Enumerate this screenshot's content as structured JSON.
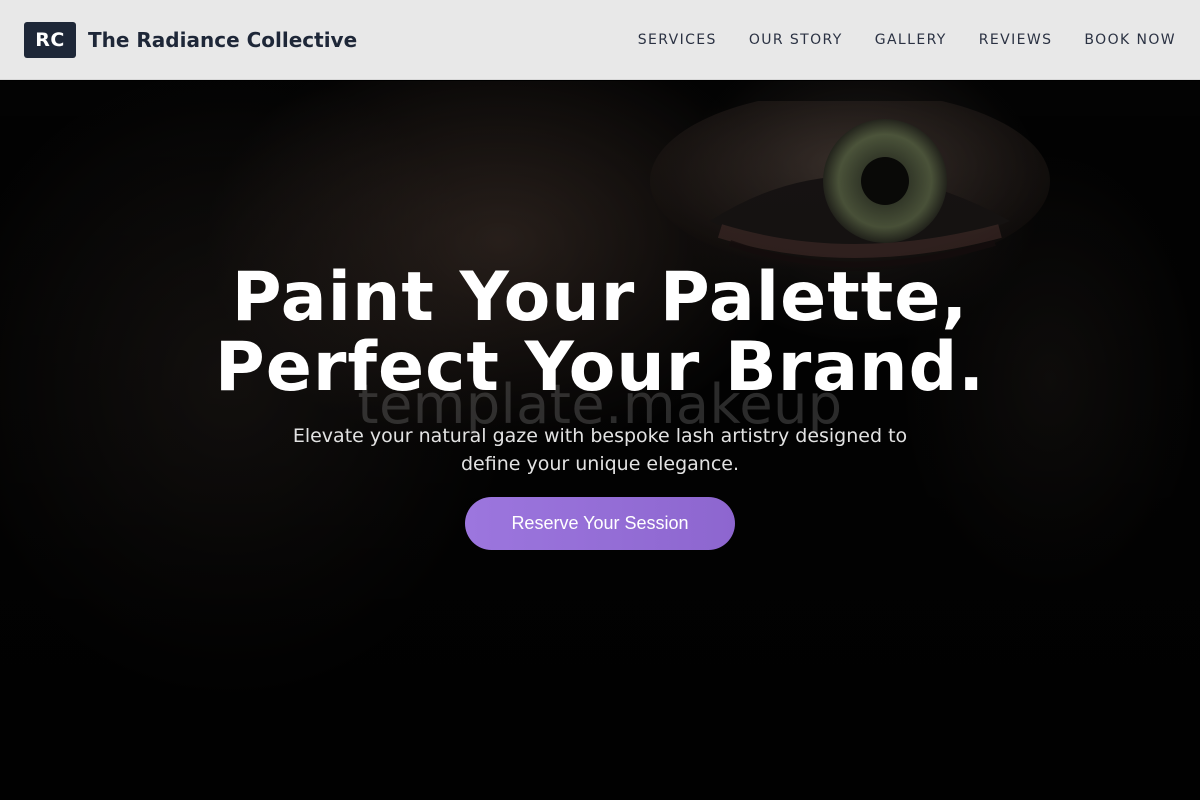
{
  "header": {
    "logo_initials": "RC",
    "brand_name": "The Radiance Collective",
    "nav": [
      {
        "label": "SERVICES"
      },
      {
        "label": "OUR STORY"
      },
      {
        "label": "GALLERY"
      },
      {
        "label": "REVIEWS"
      },
      {
        "label": "BOOK NOW"
      }
    ]
  },
  "hero": {
    "title_line1": "Paint Your Palette,",
    "title_line2": "Perfect Your Brand.",
    "subtitle_line1": "Elevate your natural gaze with bespoke lash artistry designed to",
    "subtitle_line2": "define your unique elegance.",
    "cta_label": "Reserve Your Session",
    "watermark": "template.makeup",
    "background_image": "close-up-eye-photo"
  },
  "colors": {
    "header_bg": "#e8e8e8",
    "brand_dark": "#1e2738",
    "cta_purple": "#9370db",
    "hero_text": "#ffffff"
  }
}
